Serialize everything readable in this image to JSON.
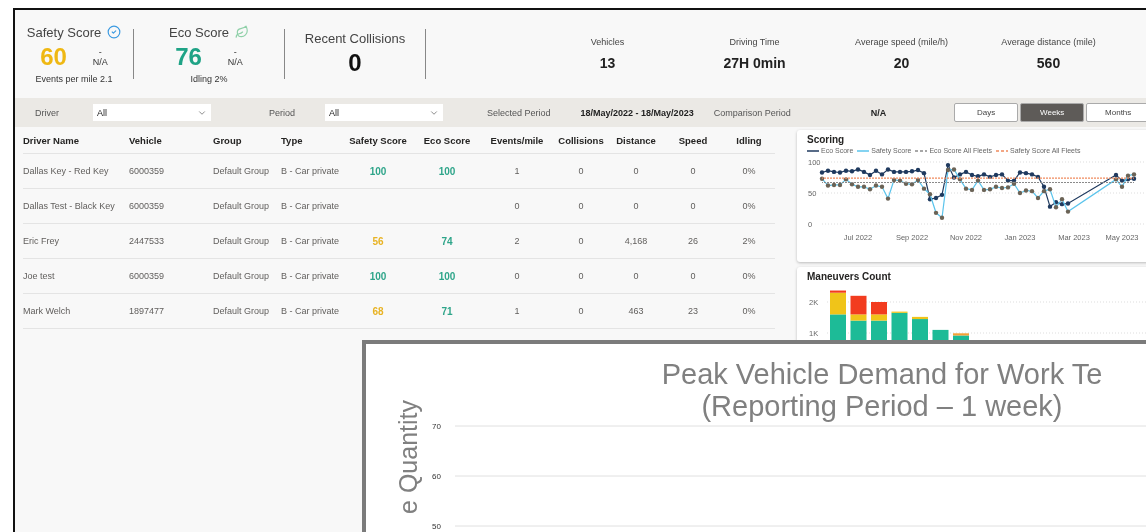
{
  "score_cards": [
    {
      "kind": "safety",
      "label": "Safety Score",
      "value": "60",
      "delta": "-",
      "comparison": "N/A",
      "note": "Events per mile 2.1",
      "color": "#efb813"
    },
    {
      "kind": "eco",
      "label": "Eco Score",
      "value": "76",
      "delta": "-",
      "comparison": "N/A",
      "note": "Idling 2%",
      "color": "#1fa386"
    },
    {
      "kind": "count",
      "label": "Recent Collisions",
      "value": "0"
    }
  ],
  "stats": [
    {
      "label": "Vehicles",
      "value": "13"
    },
    {
      "label": "Driving Time",
      "value": "27H 0min"
    },
    {
      "label": "Average speed (mile/h)",
      "value": "20"
    },
    {
      "label": "Average distance (mile)",
      "value": "560"
    }
  ],
  "filters": {
    "driver": {
      "label": "Driver",
      "value": "All"
    },
    "period": {
      "label": "Period",
      "value": "All"
    },
    "selected_period": {
      "label": "Selected Period",
      "value": "18/May/2022 - 18/May/2023"
    },
    "comparison_period": {
      "label": "Comparison Period",
      "value": "N/A"
    },
    "granularity": [
      {
        "label": "Days",
        "selected": false
      },
      {
        "label": "Weeks",
        "selected": true
      },
      {
        "label": "Months",
        "selected": false
      }
    ]
  },
  "table": {
    "columns": [
      "Driver Name",
      "Vehicle",
      "Group",
      "Type",
      "Safety Score",
      "Eco Score",
      "Events/mile",
      "Collisions",
      "Distance",
      "Speed",
      "Idling"
    ],
    "rows": [
      {
        "driver": "Dallas Key - Red Key",
        "vehicle": "6000359",
        "group": "Default Group",
        "type": "B - Car private",
        "safety_score": {
          "value": "100",
          "color": "#2fa58a"
        },
        "eco_score": {
          "value": "100",
          "color": "#2fa58a"
        },
        "events_per_mile": "1",
        "collisions": "0",
        "distance": "0",
        "speed": "0",
        "idling": "0%"
      },
      {
        "driver": "Dallas Test - Black Key",
        "vehicle": "6000359",
        "group": "Default Group",
        "type": "B - Car private",
        "events_per_mile": "0",
        "collisions": "0",
        "distance": "0",
        "speed": "0",
        "idling": "0%"
      },
      {
        "driver": "Eric Frey",
        "vehicle": "2447533",
        "group": "Default Group",
        "type": "B - Car private",
        "safety_score": {
          "value": "56",
          "color": "#e8b324"
        },
        "eco_score": {
          "value": "74",
          "color": "#2fa58a"
        },
        "events_per_mile": "2",
        "collisions": "0",
        "distance": "4,168",
        "speed": "26",
        "idling": "2%"
      },
      {
        "driver": "Joe test",
        "vehicle": "6000359",
        "group": "Default Group",
        "type": "B - Car private",
        "safety_score": {
          "value": "100",
          "color": "#2fa58a"
        },
        "eco_score": {
          "value": "100",
          "color": "#2fa58a"
        },
        "events_per_mile": "0",
        "collisions": "0",
        "distance": "0",
        "speed": "0",
        "idling": "0%"
      },
      {
        "driver": "Mark Welch",
        "vehicle": "1897477",
        "group": "Default Group",
        "type": "B - Car private",
        "safety_score": {
          "value": "68",
          "color": "#e8b324"
        },
        "eco_score": {
          "value": "71",
          "color": "#2fa58a"
        },
        "events_per_mile": "1",
        "collisions": "0",
        "distance": "463",
        "speed": "23",
        "idling": "0%"
      }
    ]
  },
  "scoring": {
    "chart_data": {
      "type": "line",
      "title": "Scoring",
      "categories": [
        null,
        null,
        null,
        null,
        null,
        null,
        "Jul 2022",
        null,
        null,
        null,
        null,
        null,
        null,
        null,
        null,
        "Sep 2022",
        null,
        null,
        null,
        null,
        null,
        null,
        null,
        null,
        "Nov 2022",
        null,
        null,
        null,
        null,
        null,
        null,
        null,
        null,
        "Jan 2023",
        null,
        null,
        null,
        null,
        null,
        null,
        null,
        null,
        "Mar 2023",
        null,
        null,
        null,
        null,
        null,
        null,
        null,
        "May 2023",
        null,
        null
      ],
      "ylim": [
        0,
        100
      ],
      "yticks": [
        0,
        50,
        100
      ],
      "series": [
        {
          "name": "Eco Score",
          "color": "#1f3a5f",
          "values": [
            83,
            86,
            84,
            83,
            86,
            85,
            88,
            84,
            79,
            86,
            80,
            88,
            84,
            84,
            84,
            85,
            87,
            82,
            40,
            42,
            47,
            95,
            75,
            80,
            84,
            79,
            77,
            80,
            76,
            79,
            80,
            70,
            70,
            83,
            82,
            80,
            76,
            60,
            28,
            35,
            32,
            33,
            null,
            null,
            null,
            null,
            null,
            null,
            null,
            79,
            70,
            72,
            73
          ]
        },
        {
          "name": "Safety Score",
          "color": "#5bc4ec",
          "values": [
            73,
            62,
            63,
            63,
            72,
            64,
            60,
            60,
            56,
            62,
            60,
            41,
            71,
            70,
            65,
            64,
            71,
            57,
            48,
            18,
            10,
            87,
            88,
            72,
            57,
            55,
            70,
            55,
            56,
            60,
            58,
            59,
            65,
            50,
            54,
            53,
            42,
            53,
            56,
            27,
            40,
            20,
            null,
            null,
            null,
            null,
            null,
            null,
            null,
            72,
            60,
            78,
            80
          ]
        },
        {
          "name": "Eco Score All Fleets",
          "color": "#8a8a8a",
          "line_style": "dashed",
          "values": [
            67,
            67,
            67,
            67,
            67,
            67,
            67,
            67,
            67,
            67,
            67,
            67,
            67,
            67,
            67,
            67,
            67,
            67,
            67,
            67,
            67,
            67,
            67,
            67,
            67,
            67,
            67,
            67,
            67,
            67,
            67,
            67,
            67,
            67,
            67,
            67,
            67,
            67,
            67,
            67,
            67,
            67,
            67,
            67,
            67,
            67,
            67,
            67,
            67,
            67,
            67,
            67,
            67
          ]
        },
        {
          "name": "Safety Score All Fleets",
          "color": "#f08a5d",
          "line_style": "dashed",
          "values": [
            74,
            74,
            74,
            74,
            74,
            74,
            74,
            74,
            74,
            74,
            74,
            74,
            74,
            74,
            74,
            74,
            74,
            74,
            74,
            74,
            74,
            74,
            74,
            74,
            74,
            74,
            74,
            74,
            74,
            74,
            74,
            74,
            74,
            74,
            74,
            74,
            74,
            74,
            74,
            74,
            74,
            74,
            74,
            74,
            74,
            74,
            74,
            74,
            74,
            74,
            74,
            74,
            74
          ]
        }
      ]
    }
  },
  "maneuvers": {
    "title": "Maneuvers Count",
    "y_ticks": [
      "2K",
      "1K"
    ]
  },
  "overlay_window": {
    "title": "Peak Vehicle Demand for Work Te\n(Reporting Period – 1 week)",
    "y_axis_label": "e Quantity",
    "y_ticks": [
      "70",
      "60",
      "50"
    ]
  }
}
